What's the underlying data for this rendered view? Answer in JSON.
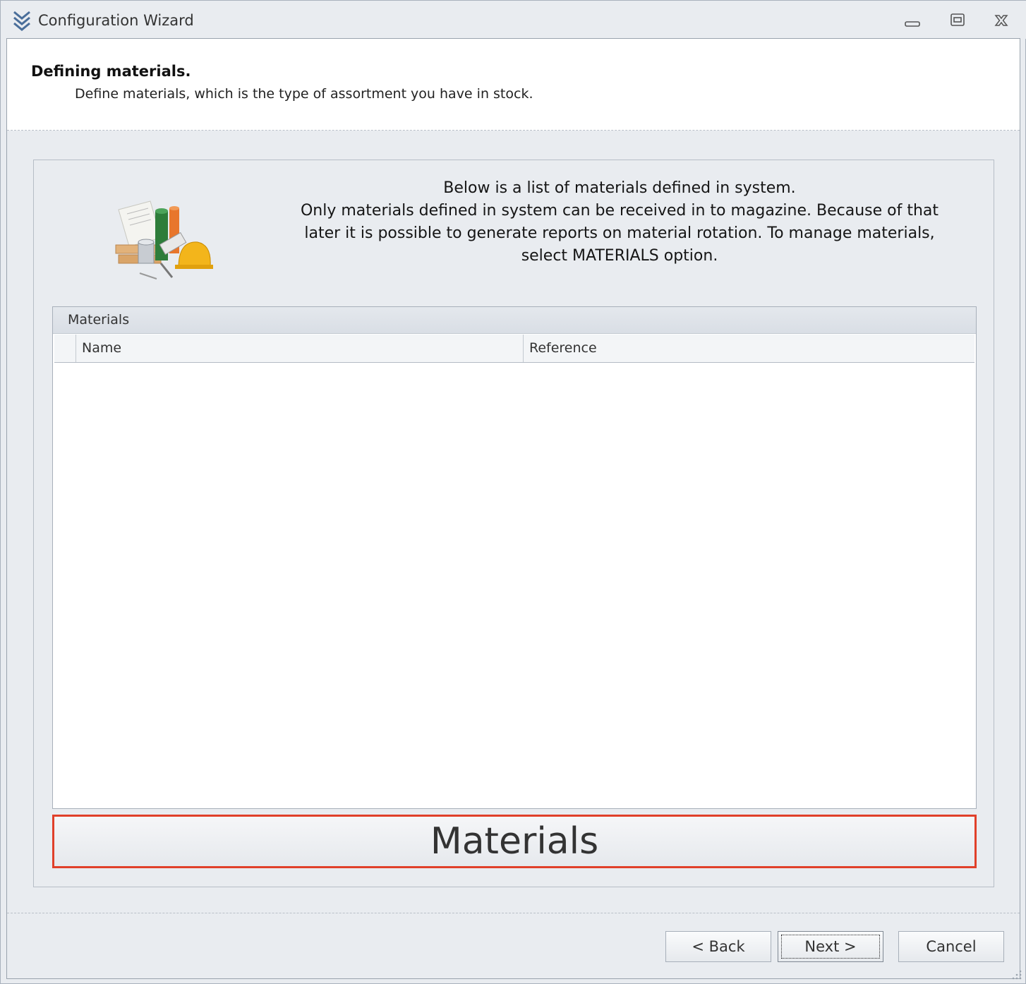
{
  "window": {
    "title": "Configuration Wizard"
  },
  "header": {
    "title": "Defining materials.",
    "description": "Define materials, which is the type of assortment you have in stock."
  },
  "info": {
    "line1": "Below is a list of materials defined in system.",
    "line2": "Only materials defined in system can be received in to magazine. Because of that later it is possible to generate reports on material rotation. To manage materials, select MATERIALS option."
  },
  "grid": {
    "caption": "Materials",
    "columns": [
      "Name",
      "Reference"
    ],
    "rows": []
  },
  "materials_button": {
    "label": "Materials",
    "border_color": "#e0402a"
  },
  "nav": {
    "back_label": "< Back",
    "next_label": "Next >",
    "cancel_label": "Cancel"
  }
}
